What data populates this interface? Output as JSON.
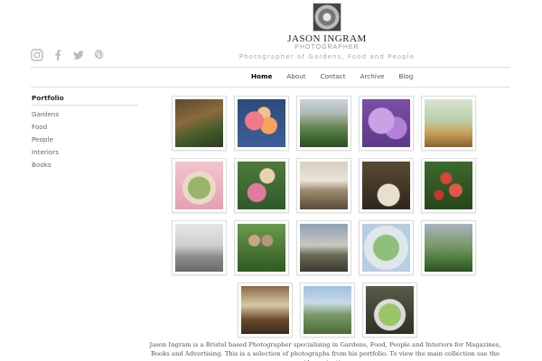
{
  "header": {
    "name": "JASON INGRAM",
    "subtitle": "PHOTOGRAPHER",
    "tagline": "Photographer of Gardens, Food and People"
  },
  "social": [
    {
      "icon": "instagram-icon"
    },
    {
      "icon": "facebook-icon"
    },
    {
      "icon": "twitter-icon"
    },
    {
      "icon": "pinterest-icon"
    }
  ],
  "nav": {
    "items": [
      "Home",
      "About",
      "Contact",
      "Archive",
      "Blog"
    ],
    "active": "Home"
  },
  "sidebar": {
    "title": "Portfolio",
    "items": [
      "Gardens",
      "Food",
      "People",
      "Interiors",
      "Books"
    ]
  },
  "footer": {
    "text": "Jason Ingram is a Bristol based Photographer specialising in Gardens, Food, People and Interiors for Magazines, Books and Advertising. This is a selection of photographs from his portfolio. To view the main collection use the side navigation."
  },
  "colors": {
    "link_active": "#000000",
    "link": "#555555",
    "divider": "#e0e0e0"
  }
}
